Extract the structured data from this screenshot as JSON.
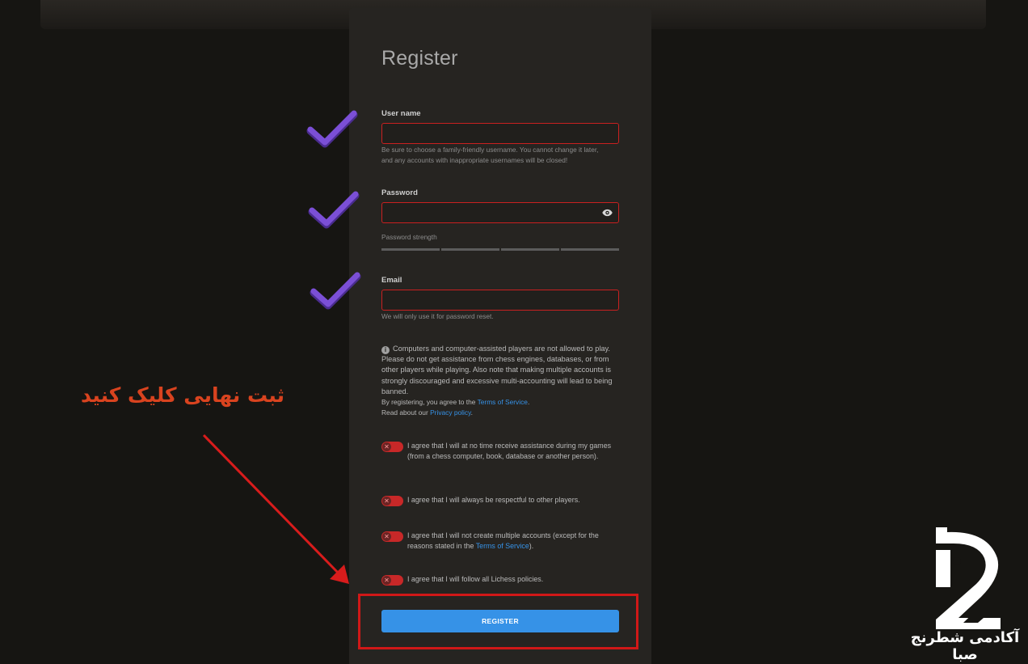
{
  "form": {
    "title": "Register",
    "username": {
      "label": "User name",
      "value": "",
      "help_line1": "Be sure to choose a family-friendly username. You cannot change it later,",
      "help_line2": "and any accounts with inappropriate usernames will be closed!"
    },
    "password": {
      "label": "Password",
      "value": "",
      "strength_label": "Password strength",
      "strength_level": 0
    },
    "email": {
      "label": "Email",
      "value": "",
      "help": "We will only use it for password reset."
    },
    "notice": {
      "text": "Computers and computer-assisted players are not allowed to play. Please do not get assistance from chess engines, databases, or from other players while playing. Also note that making multiple accounts is strongly discouraged and excessive multi-accounting will lead to being banned.",
      "tos_prefix": "By registering, you agree to the ",
      "tos_link": "Terms of Service",
      "tos_suffix": ".",
      "privacy_prefix": "Read about our ",
      "privacy_link": "Privacy policy",
      "privacy_suffix": "."
    },
    "agreements": [
      {
        "text": "I agree that I will at no time receive assistance during my games (from a chess computer, book, database or another person).",
        "checked": false
      },
      {
        "text": "I agree that I will always be respectful to other players.",
        "checked": false
      },
      {
        "text_before": "I agree that I will not create multiple accounts (except for the reasons stated in the ",
        "link": "Terms of Service",
        "text_after": ").",
        "checked": false
      },
      {
        "text": "I agree that I will follow all Lichess policies.",
        "checked": false
      }
    ],
    "register_label": "REGISTER"
  },
  "overlay": {
    "annotation_text": "ثبت نهایی کلیک کنید",
    "brand_text": "آکادمی شطرنج صبا",
    "arrow_color": "#d81c1c",
    "checkmark_color": "#7b4fd6"
  },
  "colors": {
    "background": "#161512",
    "panel": "#262421",
    "field_border_error": "#c92020",
    "accent": "#3692e7",
    "toggle_off": "#c82828"
  }
}
